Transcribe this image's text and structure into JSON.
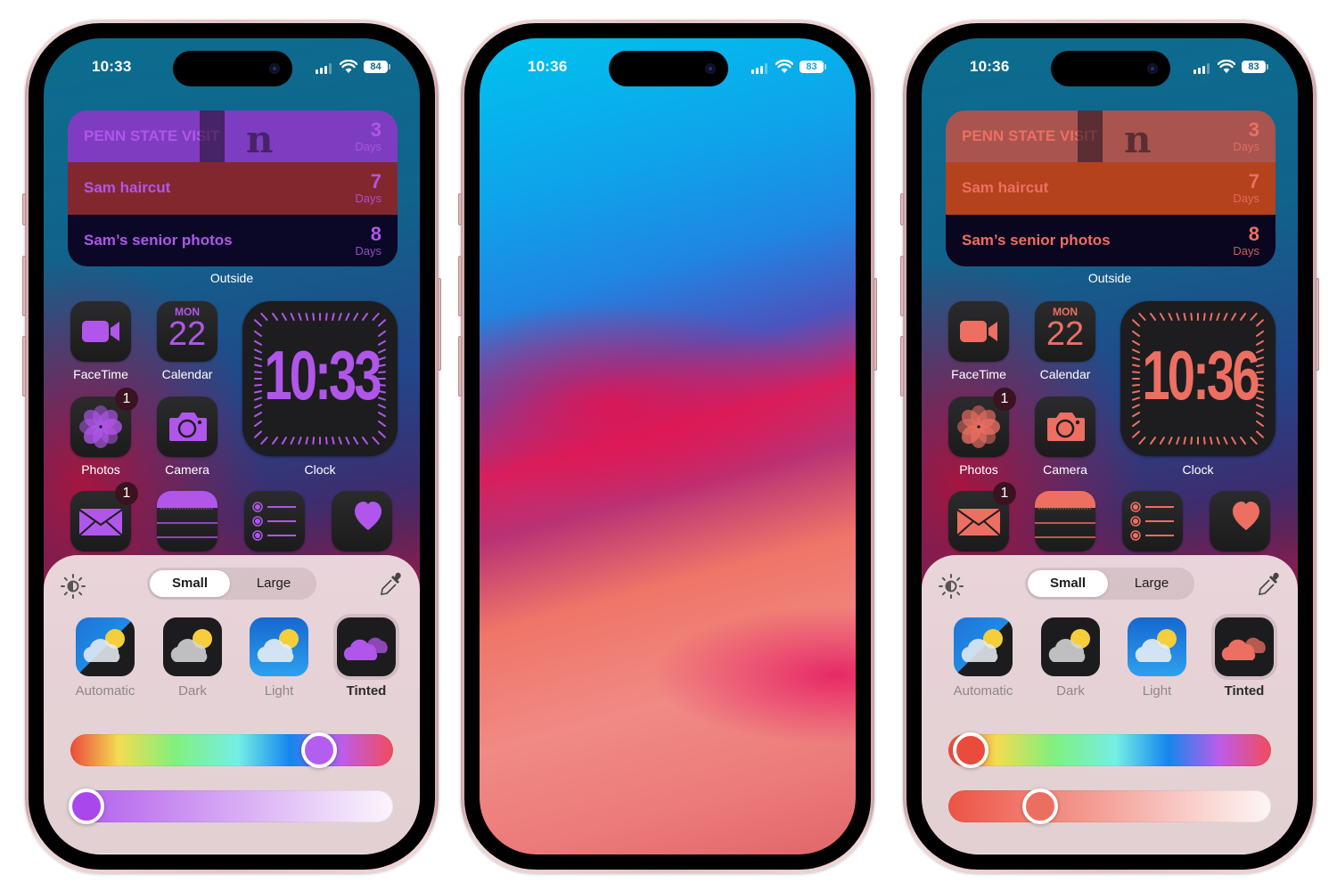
{
  "phones": [
    {
      "id": "left",
      "status": {
        "time": "10:33",
        "battery": "84"
      },
      "accent": "#b056ea",
      "countdown_widget": {
        "label": "Outside",
        "rows": [
          {
            "title": "PENN STATE VISIT",
            "count": "3",
            "unit": "Days",
            "bg": "#7e3dc0"
          },
          {
            "title": "Sam haircut",
            "count": "7",
            "unit": "Days",
            "bg": "#83272f"
          },
          {
            "title": "Sam’s senior photos",
            "count": "8",
            "unit": "Days",
            "bg": "#0a0826"
          }
        ],
        "decor_letter": "n"
      },
      "apps": [
        {
          "name": "FaceTime",
          "label": "FaceTime",
          "badge": ""
        },
        {
          "name": "Calendar",
          "label": "Calendar",
          "day": "MON",
          "date": "22",
          "badge": ""
        },
        {
          "name": "Photos",
          "label": "Photos",
          "badge": "1"
        },
        {
          "name": "Camera",
          "label": "Camera",
          "badge": ""
        },
        {
          "name": "Mail",
          "label": "",
          "badge": "1"
        },
        {
          "name": "Notes",
          "label": "",
          "badge": ""
        },
        {
          "name": "Reminders",
          "label": "",
          "badge": ""
        },
        {
          "name": "Health",
          "label": "",
          "badge": ""
        }
      ],
      "clock_widget": {
        "time": "10:33",
        "label": "Clock"
      },
      "sheet": {
        "size_options": [
          "Small",
          "Large"
        ],
        "selected_size": "Small",
        "styles": [
          "Automatic",
          "Dark",
          "Light",
          "Tinted"
        ],
        "selected_style": "Tinted",
        "hue_value": 0.8,
        "saturation_value": 0.0,
        "hue_thumb_color": "#b35ef0",
        "sat_thumb_color": "#a947ec",
        "sat_gradient_start": "#b15cec",
        "sat_gradient_end": "#fbf6fc"
      }
    },
    {
      "id": "middle",
      "status": {
        "time": "10:36",
        "battery": "83"
      },
      "wallpaper": "blue-pink-gradient"
    },
    {
      "id": "right",
      "status": {
        "time": "10:36",
        "battery": "83"
      },
      "accent": "#ec6f62",
      "countdown_widget": {
        "label": "Outside",
        "rows": [
          {
            "title": "PENN STATE VISIT",
            "count": "3",
            "unit": "Days",
            "bg": "#a9544f"
          },
          {
            "title": "Sam haircut",
            "count": "7",
            "unit": "Days",
            "bg": "#b4421d"
          },
          {
            "title": "Sam’s senior photos",
            "count": "8",
            "unit": "Days",
            "bg": "#0a0620"
          }
        ],
        "decor_letter": "n"
      },
      "apps": [
        {
          "name": "FaceTime",
          "label": "FaceTime",
          "badge": ""
        },
        {
          "name": "Calendar",
          "label": "Calendar",
          "day": "MON",
          "date": "22",
          "badge": ""
        },
        {
          "name": "Photos",
          "label": "Photos",
          "badge": "1"
        },
        {
          "name": "Camera",
          "label": "Camera",
          "badge": ""
        },
        {
          "name": "Mail",
          "label": "",
          "badge": "1"
        },
        {
          "name": "Notes",
          "label": "",
          "badge": ""
        },
        {
          "name": "Reminders",
          "label": "",
          "badge": ""
        },
        {
          "name": "Health",
          "label": "",
          "badge": ""
        }
      ],
      "clock_widget": {
        "time": "10:36",
        "label": "Clock"
      },
      "sheet": {
        "size_options": [
          "Small",
          "Large"
        ],
        "selected_size": "Small",
        "styles": [
          "Automatic",
          "Dark",
          "Light",
          "Tinted"
        ],
        "selected_style": "Tinted",
        "hue_value": 0.02,
        "saturation_value": 0.26,
        "hue_thumb_color": "#ea4b3c",
        "sat_thumb_color": "#ec6e60",
        "sat_gradient_start": "#ec5444",
        "sat_gradient_end": "#fdf6f5"
      }
    }
  ]
}
